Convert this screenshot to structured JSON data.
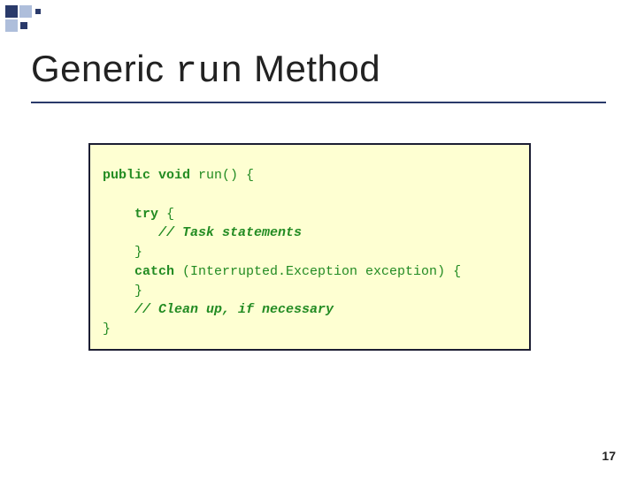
{
  "title": {
    "part1": "Generic ",
    "mono": "run",
    "part2": " Method"
  },
  "code": {
    "l1_kw": "public void ",
    "l1_rest": "run() {",
    "l2_blank": " ",
    "l3_kw": "    try ",
    "l3_rest": "{",
    "l4_com": "       // Task statements",
    "l5": "    }",
    "l6_kw": "    catch ",
    "l6_rest": "(Interrupted.Exception exception) {",
    "l7": "    }",
    "l8_com": "    // Clean up, if necessary",
    "l9": "}"
  },
  "page_number": "17"
}
